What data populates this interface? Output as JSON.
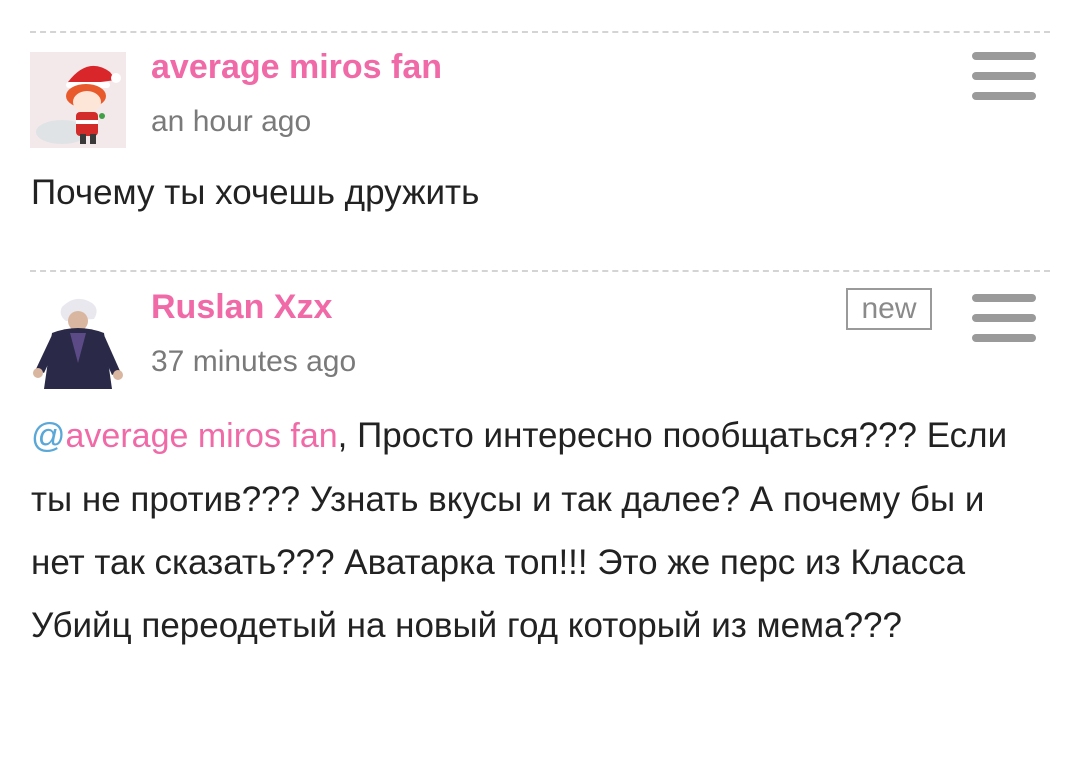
{
  "colors": {
    "accent": "#f06aa8",
    "mention_at": "#5aa8d8",
    "menu_icon": "#9a9a9a",
    "text": "#222222",
    "muted": "#7a7a7a"
  },
  "comments": [
    {
      "author": "average miros fan",
      "time": "an hour ago",
      "avatar_icon": "santa-chibi-avatar",
      "text": "Почему ты хочешь дружить",
      "menu_icon": "hamburger-menu-icon"
    },
    {
      "author": "Ruslan Xzx",
      "time": "37 minutes ago",
      "avatar_icon": "anime-character-avatar",
      "badge": "new",
      "mention_at": "@",
      "mention_name": "average miros fan",
      "text": ", Просто интересно пообщаться??? Если ты не против??? Узнать вкусы и так далее? А почему бы и нет так сказать??? Аватарка топ!!! Это же перс из Класса Убийц переодетый на новый год который из мема???",
      "menu_icon": "hamburger-menu-icon"
    }
  ]
}
